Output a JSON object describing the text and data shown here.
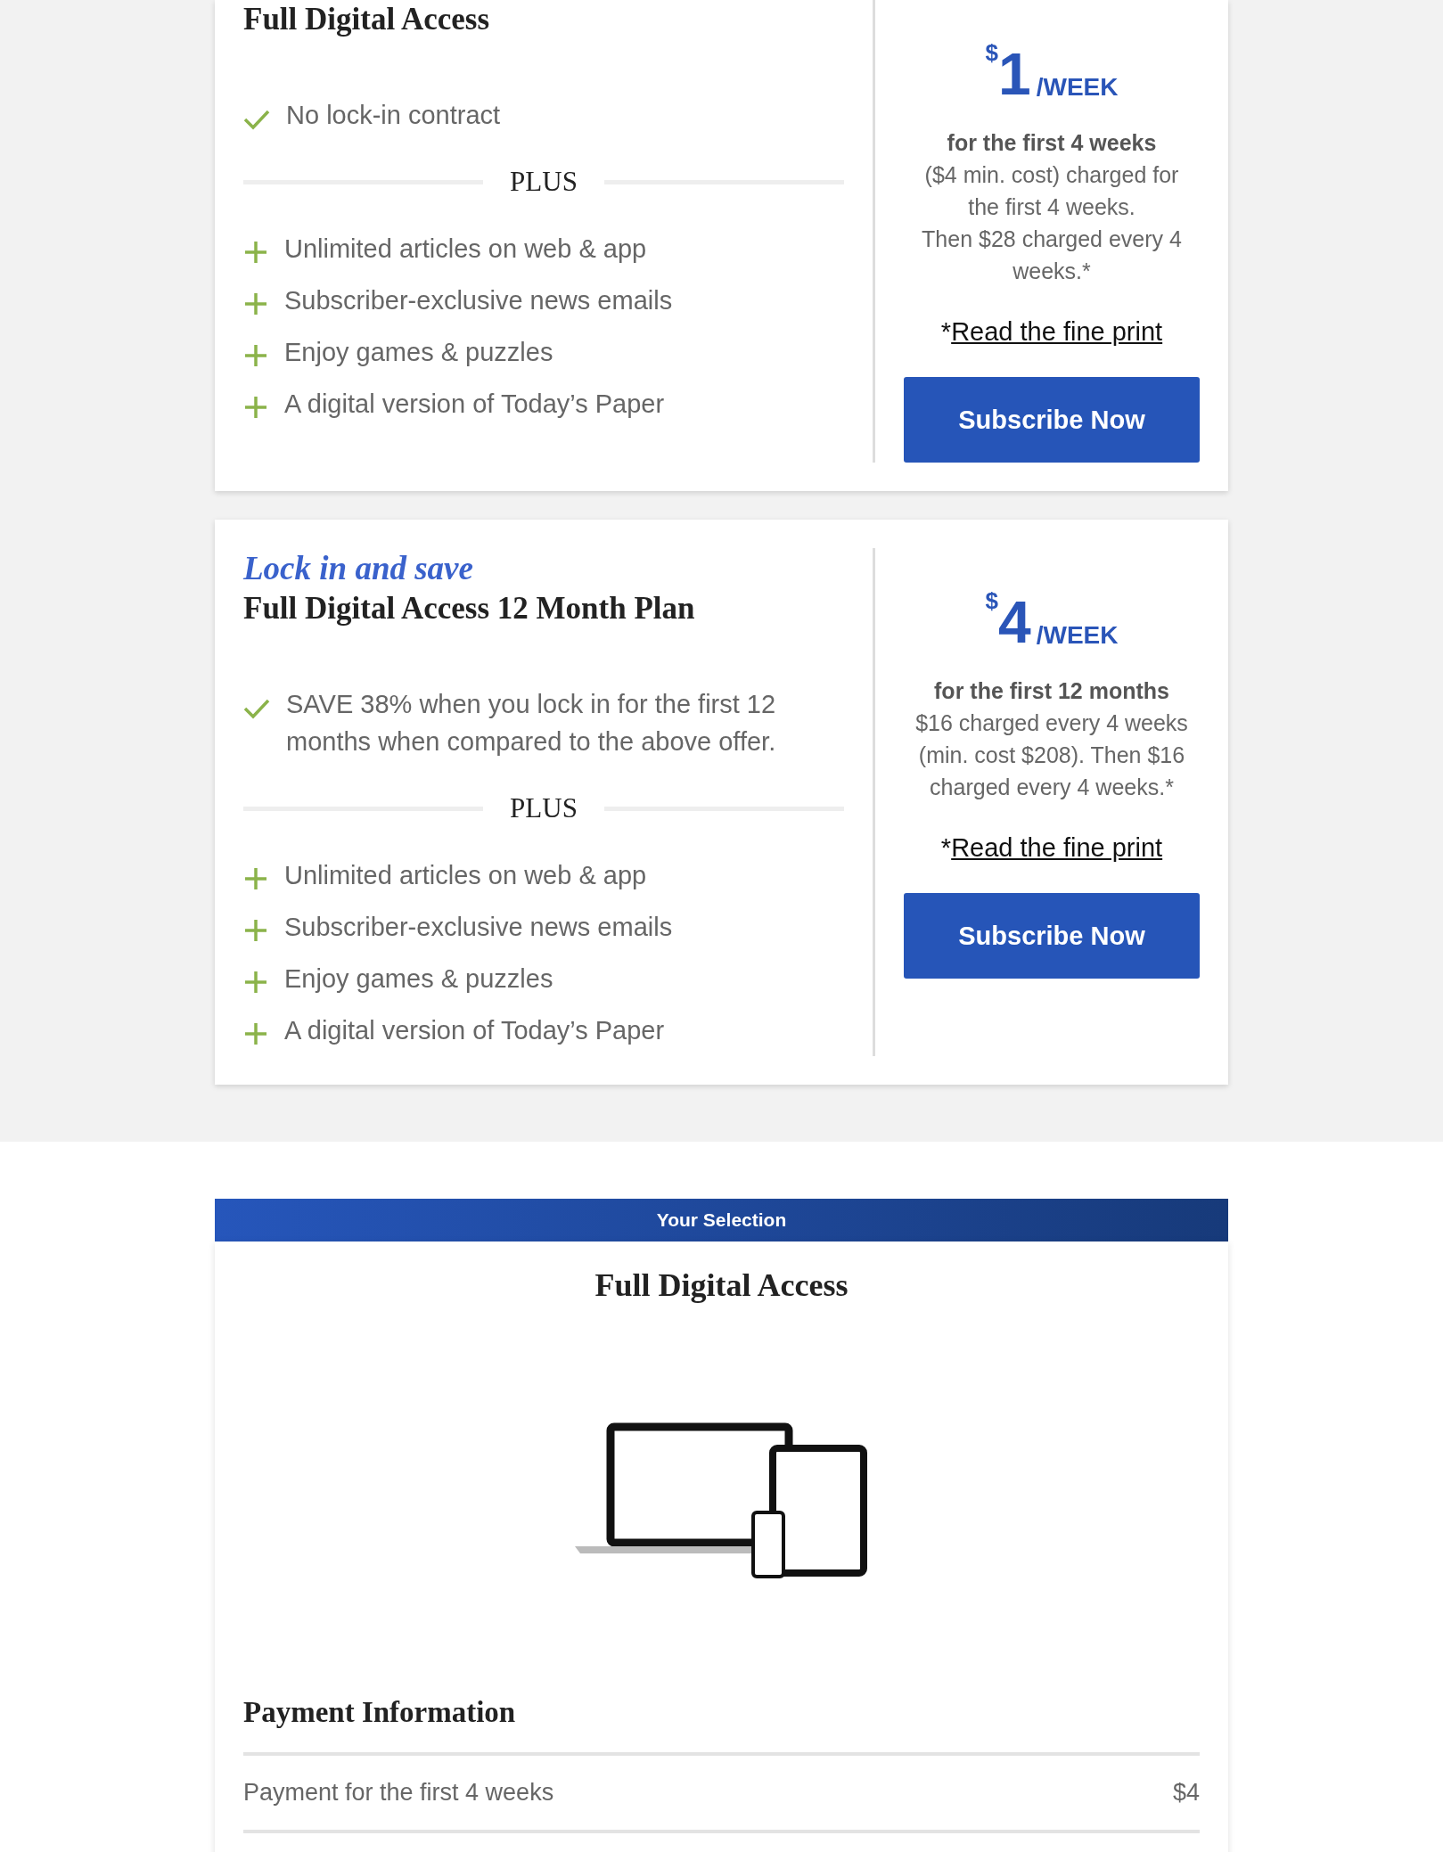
{
  "plans": [
    {
      "title": "Full Digital Access",
      "highlight": "No lock-in contract",
      "plus_label": "PLUS",
      "features": [
        "Unlimited articles on web & app",
        "Subscriber-exclusive news emails",
        "Enjoy games & puzzles",
        "A digital version of Today’s Paper"
      ],
      "price": {
        "currency": "$",
        "amount": "1",
        "unit": "/WEEK"
      },
      "terms_bold": "for the first 4 weeks",
      "terms": [
        "($4 min. cost) charged for the first 4 weeks.",
        "Then $28 charged every 4 weeks.*"
      ],
      "fine_print": {
        "prefix": "*",
        "link": "Read the fine print"
      },
      "button": "Subscribe Now"
    },
    {
      "eyebrow": "Lock in and save",
      "title": "Full Digital Access 12 Month Plan",
      "highlight": "SAVE 38% when you lock in for the first 12 months when compared to the above offer.",
      "plus_label": "PLUS",
      "features": [
        "Unlimited articles on web & app",
        "Subscriber-exclusive news emails",
        "Enjoy games & puzzles",
        "A digital version of Today’s Paper"
      ],
      "price": {
        "currency": "$",
        "amount": "4",
        "unit": "/WEEK"
      },
      "terms_bold": "for the first 12 months",
      "terms": [
        "$16 charged every 4 weeks (min. cost $208). Then $16 charged every 4 weeks.*"
      ],
      "fine_print": {
        "prefix": "*",
        "link": "Read the fine print"
      },
      "button": "Subscribe Now"
    }
  ],
  "selection": {
    "banner": "Your Selection",
    "title": "Full Digital Access",
    "payment_heading": "Payment Information",
    "payment_rows": [
      {
        "label": "Payment for the first 4 weeks",
        "amount": "$4"
      }
    ]
  }
}
